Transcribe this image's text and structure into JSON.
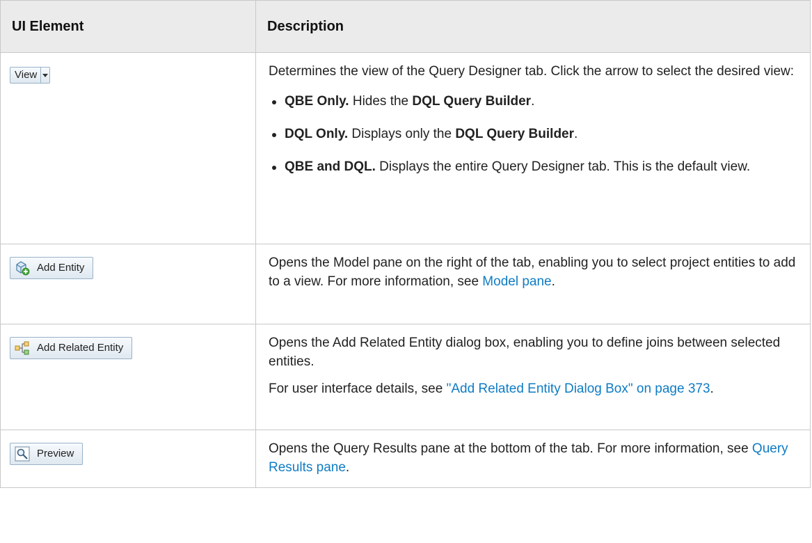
{
  "table": {
    "headers": [
      "UI Element",
      "Description"
    ]
  },
  "rows": {
    "view": {
      "button_label": "View",
      "intro": "Determines the view of the Query Designer tab. Click the arrow to select the desired view:",
      "options": [
        {
          "name": "QBE Only.",
          "pre": " Hides the ",
          "target": "DQL Query Builder",
          "post": "."
        },
        {
          "name": "DQL Only.",
          "pre": " Displays only the ",
          "target": "DQL Query Builder",
          "post": "."
        },
        {
          "name": "QBE and DQL.",
          "text": " Displays the entire Query Designer tab. This is the default view."
        }
      ]
    },
    "add_entity": {
      "button_label": "Add Entity",
      "text": "Opens the Model pane on the right of the tab, enabling you to select project entities to add to a view. For more information, see ",
      "link": "Model pane",
      "end": "."
    },
    "add_related": {
      "button_label": "Add Related Entity",
      "text1": "Opens the Add Related Entity dialog box, enabling you to define joins between selected entities.",
      "text2": "For user interface details, see ",
      "link": "\"Add Related Entity Dialog Box\" on page 373",
      "end": "."
    },
    "preview": {
      "button_label": "Preview",
      "text": "Opens the Query Results pane at the bottom of the tab. For more information, see ",
      "link": "Query Results pane",
      "end": "."
    }
  },
  "icons": {
    "view_arrow": "dropdown-arrow-icon",
    "add_entity": "add-entity-icon",
    "add_related": "related-entity-icon",
    "preview": "magnifier-icon"
  },
  "colors": {
    "link": "#0e7cc4",
    "header_bg": "#ebebeb",
    "border": "#c8c8c8"
  }
}
